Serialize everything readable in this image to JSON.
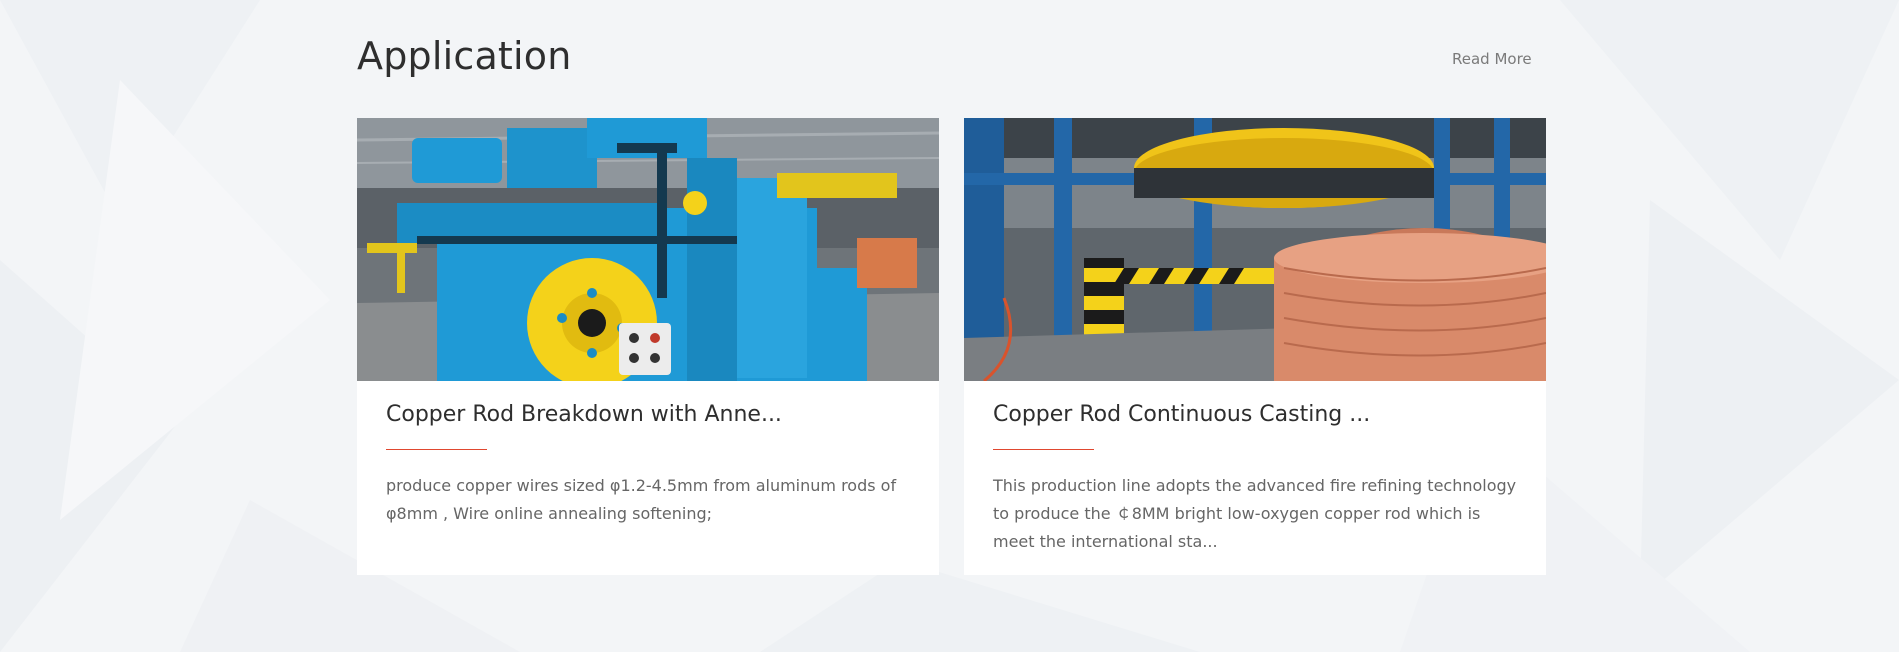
{
  "section": {
    "title": "Application",
    "read_more_label": "Read More"
  },
  "cards": [
    {
      "title": "Copper Rod Breakdown with Anne...",
      "description": "produce copper wires sized φ1.2-4.5mm from aluminum rods of φ8mm , Wire online annealing softening;",
      "image_alt": "Copper rod breakdown machine with blue frame and yellow wheel"
    },
    {
      "title": "Copper Rod Continuous Casting ...",
      "description": "This production line adopts the advanced fire refining technology to produce the ￠8MM bright low-oxygen copper rod which is meet the international sta...",
      "image_alt": "Copper rod continuous casting line with coil of copper rod"
    }
  ],
  "colors": {
    "accent_rule": "#e0472f",
    "machine_blue": "#1f9ad6",
    "machine_yellow": "#f4d21a",
    "copper": "#d98a6a"
  }
}
